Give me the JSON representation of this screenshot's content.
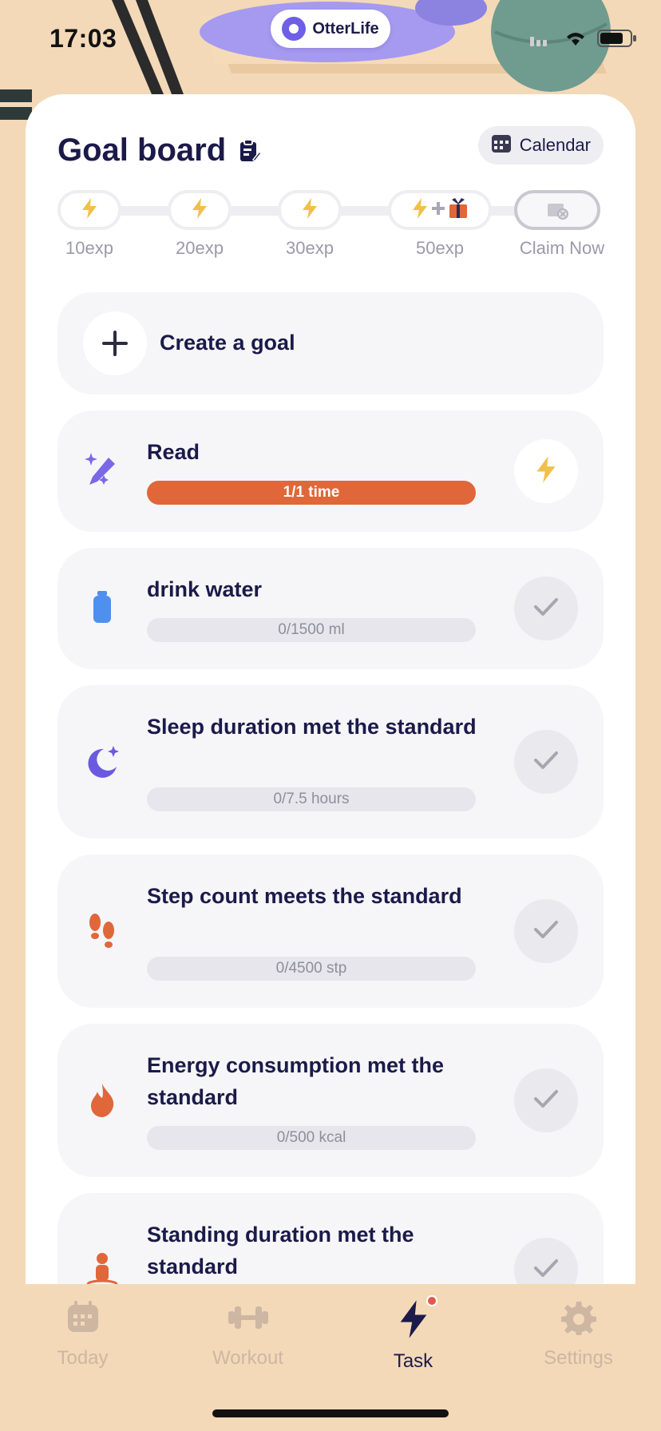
{
  "status_bar": {
    "time": "17:03"
  },
  "brand": {
    "name": "OtterLife"
  },
  "header": {
    "title": "Goal board",
    "calendar_label": "Calendar"
  },
  "tracker": {
    "milestones": [
      {
        "label": "10exp"
      },
      {
        "label": "20exp"
      },
      {
        "label": "30exp"
      },
      {
        "label": "50exp"
      },
      {
        "label": "Claim Now"
      }
    ]
  },
  "create_goal": {
    "label": "Create a goal"
  },
  "goals": [
    {
      "title": "Read",
      "progress": "1/1 time",
      "icon": "magic-pen-icon",
      "completed": true
    },
    {
      "title": "drink water",
      "progress": "0/1500 ml",
      "icon": "water-bottle-icon",
      "completed": false
    },
    {
      "title": "Sleep duration met the standard",
      "progress": "0/7.5 hours",
      "icon": "moon-icon",
      "completed": false
    },
    {
      "title": "Step count meets the standard",
      "progress": "0/4500 stp",
      "icon": "footprints-icon",
      "completed": false
    },
    {
      "title": "Energy consumption met the standard",
      "progress": "0/500 kcal",
      "icon": "flame-icon",
      "completed": false
    },
    {
      "title": "Standing duration met the standard",
      "progress": "",
      "icon": "standing-person-icon",
      "completed": false
    }
  ],
  "tabbar": {
    "tabs": [
      {
        "label": "Today",
        "icon": "calendar-icon"
      },
      {
        "label": "Workout",
        "icon": "dumbbell-icon"
      },
      {
        "label": "Task",
        "icon": "lightning-icon",
        "active": true
      },
      {
        "label": "Settings",
        "icon": "gear-icon"
      }
    ]
  },
  "colors": {
    "accent": "#e0673a",
    "primary_text": "#1b1a4a",
    "background": "#f3d9b8",
    "lightning": "#f2c04a"
  }
}
